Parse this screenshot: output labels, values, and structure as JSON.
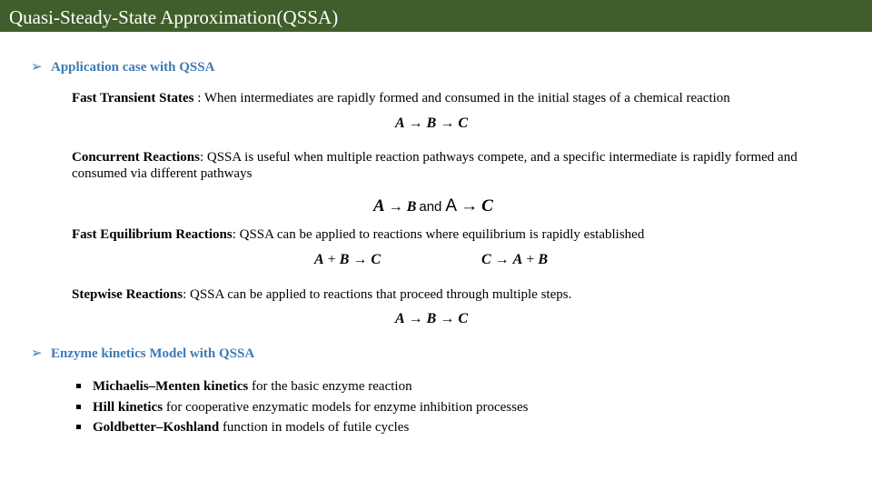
{
  "header": {
    "title": "Quasi-Steady-State Approximation(QSSA)"
  },
  "colors": {
    "title_bar": "#3f5e2b",
    "section_heading": "#3e7ab5"
  },
  "sections": {
    "application": {
      "arrow": "➢",
      "heading": "Application case with QSSA",
      "items": [
        {
          "term": "Fast Transient States",
          "text": " : When intermediates are rapidly formed and consumed in the initial stages of a chemical reaction"
        },
        {
          "term": "Concurrent Reactions",
          "text": ": QSSA is useful when multiple reaction pathways compete, and a specific intermediate is rapidly formed and consumed via different pathways"
        },
        {
          "term": "Fast Equilibrium Reactions",
          "text": ": QSSA can be applied to reactions where equilibrium is rapidly established"
        },
        {
          "term": "Stepwise Reactions",
          "text": ": QSSA can be applied to reactions that proceed through multiple steps."
        }
      ],
      "equations": {
        "eq1": {
          "a": "A",
          "arrow1": "→",
          "b": "B",
          "arrow2": "→",
          "c": "C"
        },
        "eq2": {
          "a": "A",
          "arrow1": "→",
          "b": "B",
          "and": "and",
          "a2": "A",
          "arrow2": "→",
          "c": "C"
        },
        "eq3": {
          "a": "A",
          "plus": "+",
          "b": "B",
          "arrow": "→",
          "c": "C"
        },
        "eq4": {
          "c": "C",
          "arrow": "→",
          "a": "A",
          "plus": "+",
          "b": "B"
        },
        "eq5": {
          "a": "A",
          "arrow1": "→",
          "b": "B",
          "arrow2": "→",
          "c": "C"
        }
      }
    },
    "enzyme": {
      "arrow": "➢",
      "heading": "Enzyme kinetics Model with QSSA",
      "bullets": [
        {
          "term": "Michaelis–Menten kinetics",
          "text": " for the basic enzyme reaction"
        },
        {
          "term": "Hill kinetics",
          "text": " for cooperative enzymatic models for enzyme inhibition processes"
        },
        {
          "term": "Goldbetter–Koshland",
          "text": " function in models of futile cycles"
        }
      ]
    }
  }
}
